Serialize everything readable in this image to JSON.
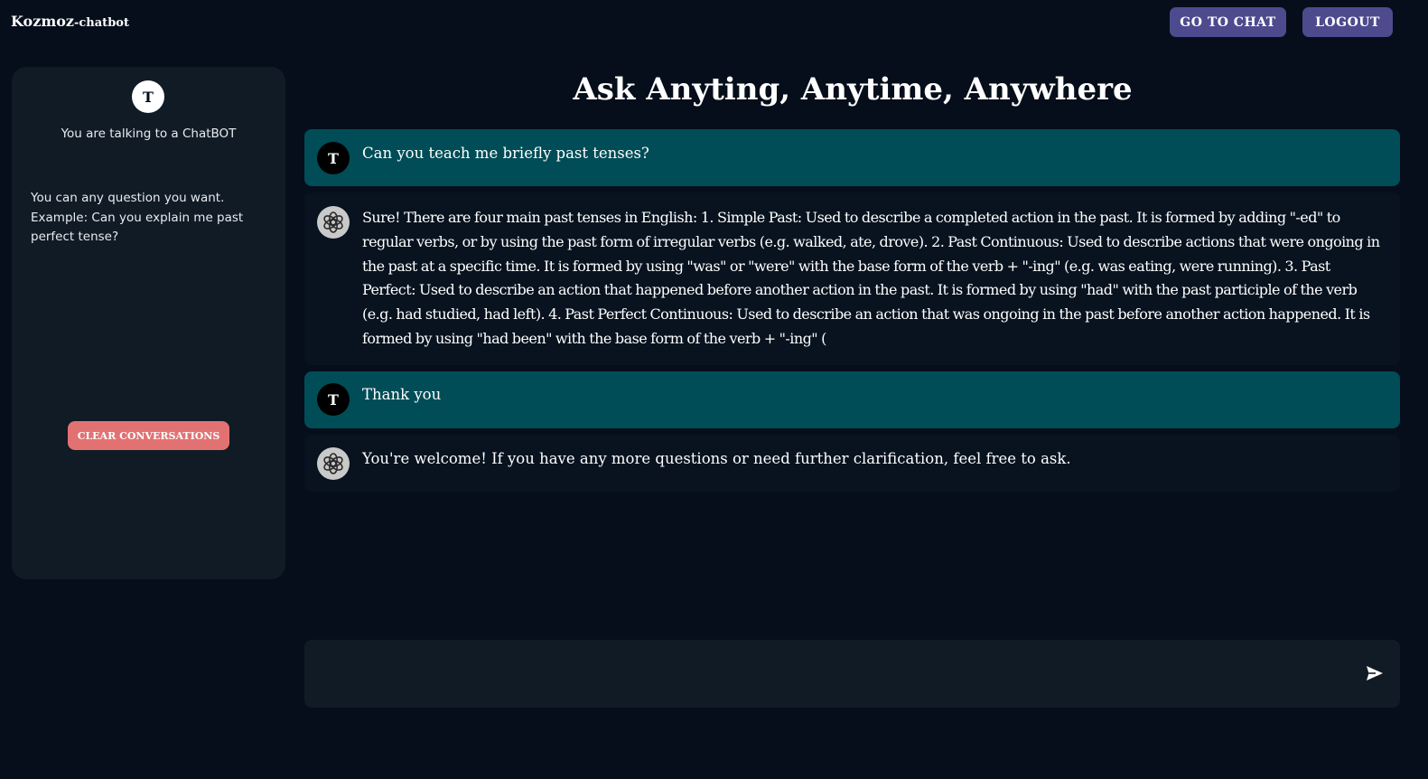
{
  "header": {
    "brand": "Kozmoz",
    "brand_suffix": "-chatbot",
    "go_to_chat_label": "GO TO CHAT",
    "logout_label": "LOGOUT"
  },
  "sidebar": {
    "avatar_initial": "T",
    "status_text": "You are talking to a ChatBOT",
    "hint_text": "You can any question you want. Example: Can you explain me past perfect tense?",
    "clear_button_label": "CLEAR CONVERSATIONS"
  },
  "main": {
    "title": "Ask Anyting, Anytime, Anywhere",
    "messages": [
      {
        "role": "user",
        "avatar": "T",
        "text": "Can you teach me briefly past tenses?"
      },
      {
        "role": "bot",
        "avatar_icon": "openai-logo-icon",
        "text": "Sure! There are four main past tenses in English: 1. Simple Past: Used to describe a completed action in the past. It is formed by adding \"-ed\" to regular verbs, or by using the past form of irregular verbs (e.g. walked, ate, drove). 2. Past Continuous: Used to describe actions that were ongoing in the past at a specific time. It is formed by using \"was\" or \"were\" with the base form of the verb + \"-ing\" (e.g. was eating, were running). 3. Past Perfect: Used to describe an action that happened before another action in the past. It is formed by using \"had\" with the past participle of the verb (e.g. had studied, had left). 4. Past Perfect Continuous: Used to describe an action that was ongoing in the past before another action happened. It is formed by using \"had been\" with the base form of the verb + \"-ing\" ("
      },
      {
        "role": "user",
        "avatar": "T",
        "text": "Thank you"
      },
      {
        "role": "bot",
        "avatar_icon": "openai-logo-icon",
        "text": "You're welcome! If you have any more questions or need further clarification, feel free to ask."
      }
    ],
    "input": {
      "value": "",
      "placeholder": ""
    },
    "send_icon": "send-icon"
  },
  "colors": {
    "background": "#050e1a",
    "panel": "#111b26",
    "user_message": "#004d57",
    "bot_message": "#08131f",
    "nav_button": "#4d4b8e",
    "clear_button": "#e27272"
  }
}
